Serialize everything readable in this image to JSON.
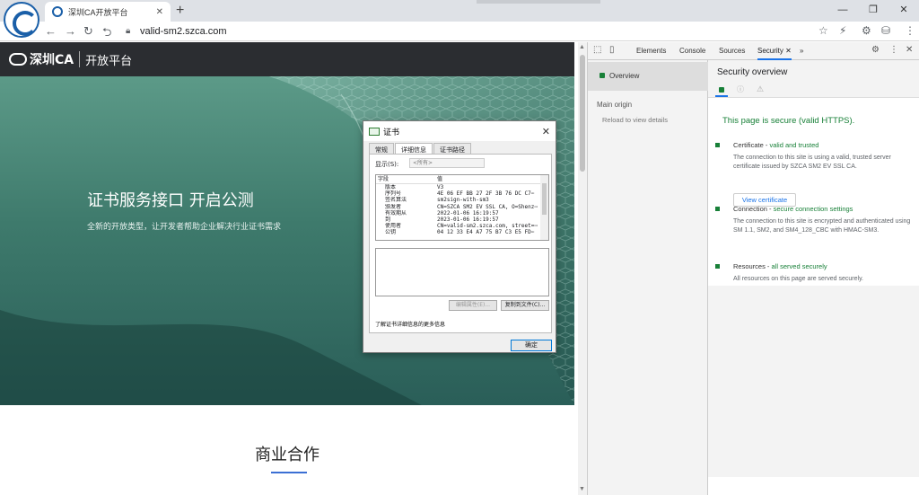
{
  "browser": {
    "tab_title": "深圳CA开放平台",
    "url": "valid-sm2.szca.com"
  },
  "site": {
    "logo_text": "深圳CA",
    "logo_subtitle": "开放平台",
    "hero_title": "证书服务接口 开启公测",
    "hero_subtitle": "全新的开放类型，让开发者帮助企业解决行业证书需求",
    "section_title": "商业合作"
  },
  "cert_dialog": {
    "title": "证书",
    "tabs": [
      "常规",
      "详细信息",
      "证书路径"
    ],
    "active_tab": "详细信息",
    "show_label": "显示(S):",
    "show_value": "<所有>",
    "col_field": "字段",
    "col_value": "值",
    "fields": [
      {
        "name": "版本",
        "value": "V3"
      },
      {
        "name": "序列号",
        "value": "4E 06 EF BB 27 2F 3B 76 DC C7⋯"
      },
      {
        "name": "签名算法",
        "value": "sm2sign-with-sm3"
      },
      {
        "name": "颁发者",
        "value": "CN=SZCA SM2 EV SSL CA, O=Shenz⋯"
      },
      {
        "name": "有效期从",
        "value": "2022-01-06 16:19:57"
      },
      {
        "name": "到",
        "value": "2023-01-06 16:19:57"
      },
      {
        "name": "使用者",
        "value": "CN=valid-sm2.szca.com, street=⋯"
      },
      {
        "name": "公钥",
        "value": "04 12 33 E4 A7 75 B7 C3 E5 FD⋯"
      }
    ],
    "edit_props_label": "编辑属性(E)...",
    "copy_file_label": "复制到文件(C)...",
    "info_link": "了解证书详细信息的更多信息",
    "ok_label": "确定"
  },
  "devtools": {
    "tabs": [
      "Elements",
      "Console",
      "Sources",
      "Security"
    ],
    "active_tab": "Security",
    "more_tabs": "»",
    "sidebar": {
      "overview": "Overview",
      "main_origin": "Main origin",
      "reload": "Reload to view details"
    },
    "security": {
      "title": "Security overview",
      "secure_message": "This page is secure (valid HTTPS).",
      "items": [
        {
          "label": "Certificate - ",
          "status": "valid and trusted",
          "desc": "The connection to this site is using a valid, trusted server certificate issued by SZCA SM2 EV SSL CA."
        },
        {
          "label": "Connection - ",
          "status": "secure connection settings",
          "desc": "The connection to this site is encrypted and authenticated using SM 1.1, SM2, and SM4_128_CBC with HMAC-SM3."
        },
        {
          "label": "Resources - ",
          "status": "all served securely",
          "desc": "All resources on this page are served securely."
        }
      ],
      "view_certificate": "View certificate"
    }
  },
  "colors": {
    "secure_green": "#188038",
    "link_blue": "#1a73e8",
    "header_dark": "#2b2d31",
    "hero_teal": "#3e7a6c"
  }
}
